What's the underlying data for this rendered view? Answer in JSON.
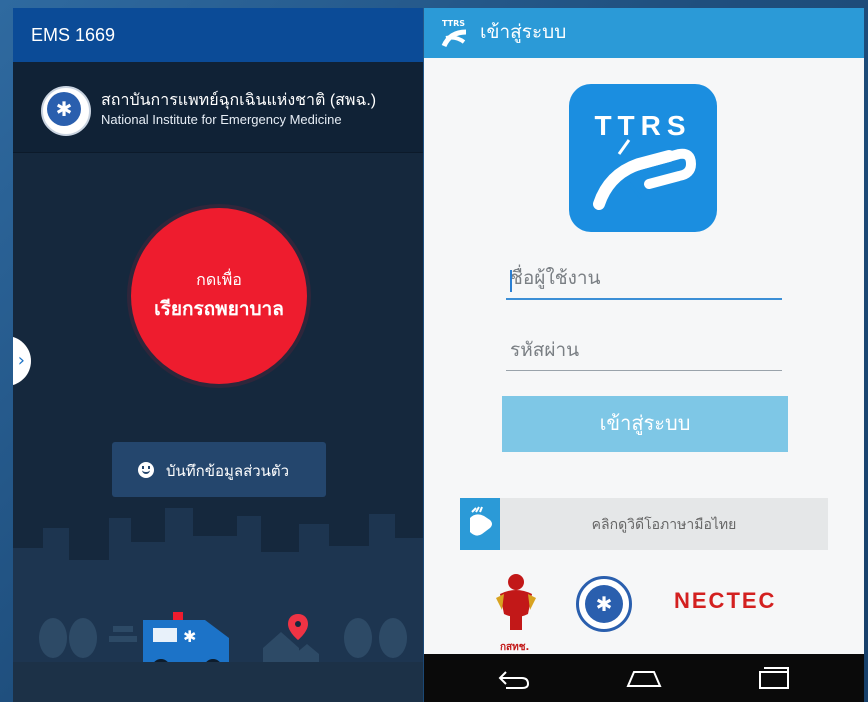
{
  "ems": {
    "app_title": "EMS 1669",
    "org_name_th": "สถาบันการแพทย์ฉุกเฉินแห่งชาติ (สพฉ.)",
    "org_name_en": "National Institute for Emergency Medicine",
    "call_button": {
      "line1": "กดเพื่อ",
      "line2": "เรียกรถพยาบาล"
    },
    "profile_button": "บันทึกข้อมูลส่วนตัว",
    "side_tab_icon": "chevron-right-icon",
    "colors": {
      "bar": "#0b4b97",
      "background": "#15283d",
      "call": "#ee1c2e"
    }
  },
  "ttrs": {
    "screen_title": "เข้าสู่ระบบ",
    "logo_text": "TTRS",
    "username_placeholder": "ชื่อผู้ใช้งาน",
    "password_placeholder": "รหัสผ่าน",
    "login_button": "เข้าสู่ระบบ",
    "sign_video_link": "คลิกดูวิดีโอภาษามือไทย",
    "partner_logos": {
      "garuda_label": "กสทช.",
      "nectec": "NECTEC"
    },
    "nav": [
      "back-icon",
      "home-icon",
      "recents-icon"
    ],
    "colors": {
      "bar": "#2b9ad7",
      "button": "#7ec7e6",
      "logo": "#1b8ee0"
    }
  }
}
